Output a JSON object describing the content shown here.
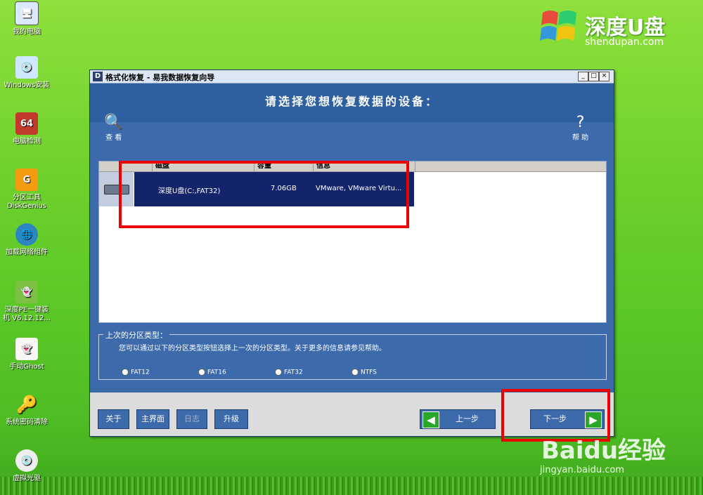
{
  "desktop": {
    "icons": [
      {
        "label": "我的电脑",
        "color": "#dbe9ff"
      },
      {
        "label": "Windows安装",
        "color": "#cfe7ff"
      },
      {
        "label": "电脑检测",
        "color": "#c0392b",
        "glyph": "64"
      },
      {
        "label": "分区工具\nDiskGenius",
        "color": "#f39c12",
        "glyph": "G"
      },
      {
        "label": "加载网络组件",
        "color": "#2e86c1"
      },
      {
        "label": "深度PE一键装\n机 V6.12.12...",
        "color": "#7cc142"
      },
      {
        "label": "手动Ghost",
        "color": "#f7f7f7"
      },
      {
        "label": "系统密码清除",
        "color": "#f1c40f"
      },
      {
        "label": "虚拟光驱",
        "color": "#eeeeee"
      }
    ]
  },
  "logo": {
    "title": "深度U盘",
    "url": "shendupan.com"
  },
  "window": {
    "title": "格式化恢复 - 易我数据恢复向导",
    "controls": {
      "min": "_",
      "max": "□",
      "close": "×"
    },
    "prompt": "请选择您想恢复数据的设备：",
    "toolbar": {
      "view": "查 看",
      "help": "帮 助"
    },
    "list": {
      "columns": [
        "磁盘",
        "容量",
        "信息"
      ],
      "rows": [
        {
          "disk": "深度U盘(C:,FAT32)",
          "capacity": "7.06GB",
          "info": "VMware, VMware Virtu..."
        }
      ]
    },
    "partition": {
      "legend": "上次的分区类型：",
      "description": "您可以通过以下的分区类型按钮选择上一次的分区类型。关于更多的信息请参见帮助。",
      "options": [
        "FAT12",
        "FAT16",
        "FAT32",
        "NTFS"
      ]
    },
    "buttons": {
      "about": "关于",
      "main": "主界面",
      "log": "日志",
      "upgrade": "升级",
      "prev": "上一步",
      "next": "下一步"
    }
  },
  "watermark": {
    "brand": "Baidu经验",
    "url": "jingyan.baidu.com"
  }
}
